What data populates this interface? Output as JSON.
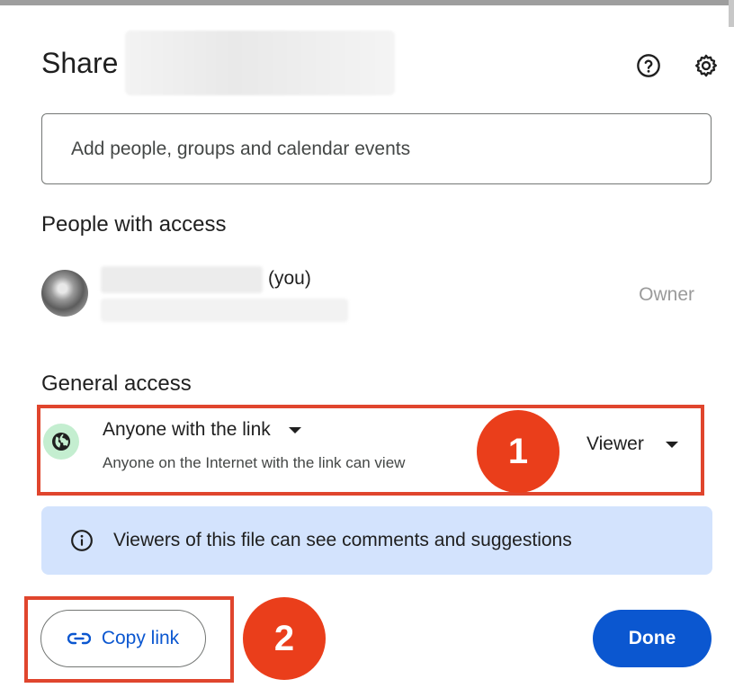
{
  "dialog": {
    "title": "Share",
    "help_icon": "help-circle-icon",
    "settings_icon": "gear-icon"
  },
  "add_people": {
    "placeholder": "Add people, groups and calendar events",
    "value": ""
  },
  "people_with_access": {
    "heading": "People with access",
    "owner": {
      "you_label": "(you)",
      "role": "Owner"
    }
  },
  "general_access": {
    "heading": "General access",
    "icon": "globe-icon",
    "type": "Anyone with the link",
    "description": "Anyone on the Internet with the link can view",
    "role": "Viewer"
  },
  "info_banner": {
    "icon": "info-icon",
    "text": "Viewers of this file can see comments and suggestions"
  },
  "footer": {
    "copy_link_label": "Copy link",
    "copy_link_icon": "link-icon",
    "done_label": "Done"
  },
  "annotations": {
    "badge_1": "1",
    "badge_2": "2",
    "highlight_color": "#e0452d",
    "badge_color": "#ea3e1b"
  },
  "colors": {
    "primary": "#0b57d0",
    "info_background": "#d3e3fd",
    "globe_background": "#c4eed0"
  }
}
